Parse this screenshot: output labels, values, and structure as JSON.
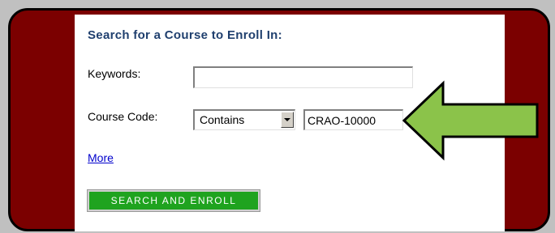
{
  "form": {
    "title": "Search for a Course to Enroll In:",
    "keywords_label": "Keywords:",
    "keywords_value": "",
    "course_code_label": "Course Code:",
    "match_type_selected": "Contains",
    "course_code_value": "CRAO-10000",
    "more_link": "More",
    "search_button": "SEARCH AND ENROLL"
  },
  "annotation": {
    "arrow_icon": "left-arrow-icon",
    "arrow_color": "#8bc34a"
  },
  "colors": {
    "frame_background": "#7b0000",
    "title_color": "#1f3f6e",
    "button_color": "#1fa31f",
    "link_color": "#0000cc"
  }
}
